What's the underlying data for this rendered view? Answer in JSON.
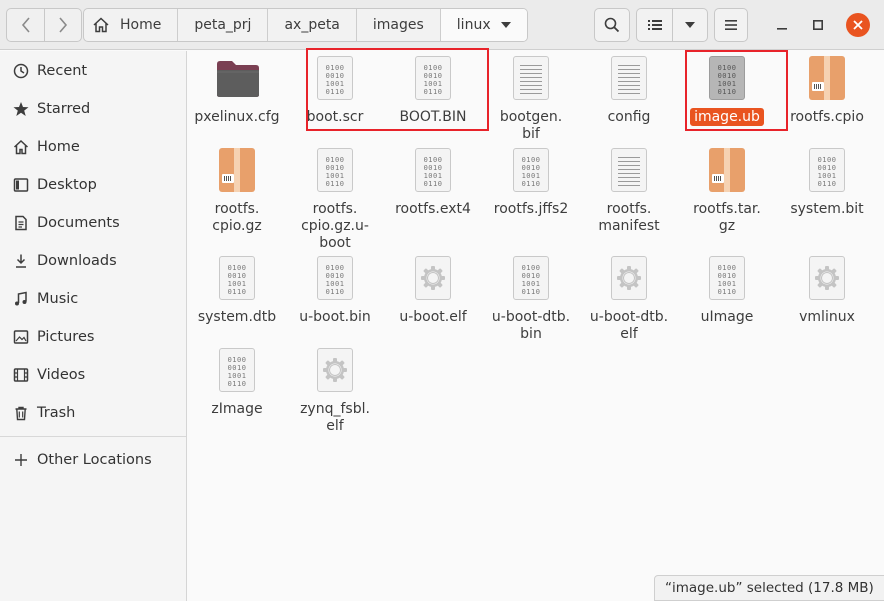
{
  "header": {
    "breadcrumbs": [
      "Home",
      "peta_prj",
      "ax_peta",
      "images",
      "linux"
    ]
  },
  "sidebar": {
    "items": [
      {
        "label": "Recent",
        "icon": "clock-icon"
      },
      {
        "label": "Starred",
        "icon": "star-icon"
      },
      {
        "label": "Home",
        "icon": "home-icon"
      },
      {
        "label": "Desktop",
        "icon": "desktop-icon"
      },
      {
        "label": "Documents",
        "icon": "document-icon"
      },
      {
        "label": "Downloads",
        "icon": "download-icon"
      },
      {
        "label": "Music",
        "icon": "music-icon"
      },
      {
        "label": "Pictures",
        "icon": "picture-icon"
      },
      {
        "label": "Videos",
        "icon": "video-icon"
      },
      {
        "label": "Trash",
        "icon": "trash-icon"
      }
    ],
    "other_locations": "Other Locations"
  },
  "files": [
    {
      "name": "pxelinux.cfg",
      "type": "folder"
    },
    {
      "name": "boot.scr",
      "type": "binary"
    },
    {
      "name": "BOOT.BIN",
      "type": "binary"
    },
    {
      "name": "bootgen.\nbif",
      "type": "text"
    },
    {
      "name": "config",
      "type": "text"
    },
    {
      "name": "image.ub",
      "type": "binary",
      "selected": true
    },
    {
      "name": "rootfs.cpio",
      "type": "archive"
    },
    {
      "name": "rootfs.\ncpio.gz",
      "type": "archive"
    },
    {
      "name": "rootfs.\ncpio.gz.u-\nboot",
      "type": "binary"
    },
    {
      "name": "rootfs.ext4",
      "type": "binary"
    },
    {
      "name": "rootfs.jffs2",
      "type": "binary"
    },
    {
      "name": "rootfs.\nmanifest",
      "type": "text"
    },
    {
      "name": "rootfs.tar.\ngz",
      "type": "archive"
    },
    {
      "name": "system.bit",
      "type": "binary"
    },
    {
      "name": "system.dtb",
      "type": "binary"
    },
    {
      "name": "u-boot.bin",
      "type": "binary"
    },
    {
      "name": "u-boot.elf",
      "type": "executable"
    },
    {
      "name": "u-boot-dtb.\nbin",
      "type": "binary"
    },
    {
      "name": "u-boot-dtb.\nelf",
      "type": "executable"
    },
    {
      "name": "uImage",
      "type": "binary"
    },
    {
      "name": "vmlinux",
      "type": "executable"
    },
    {
      "name": "zImage",
      "type": "binary"
    },
    {
      "name": "zynq_fsbl.\nelf",
      "type": "executable"
    }
  ],
  "binary_glyph": [
    "0100",
    "0010",
    "1001",
    "0110"
  ],
  "status": "“image.ub” selected (17.8 MB)",
  "colors": {
    "accent": "#e95420",
    "annotation": "#e8232a",
    "folder": "#7a3f52"
  }
}
